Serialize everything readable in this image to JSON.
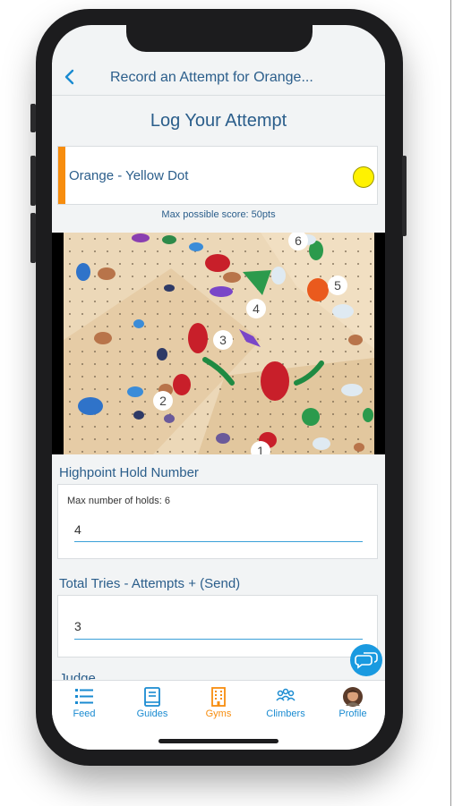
{
  "nav": {
    "title": "Record an Attempt for Orange..."
  },
  "heading": "Log Your Attempt",
  "route": {
    "name": "Orange - Yellow Dot",
    "stripe_color": "#f78d0e",
    "dot_color": "#fff200"
  },
  "max_score": "Max possible score: 50pts",
  "hold_numbers": [
    "1",
    "2",
    "3",
    "4",
    "5",
    "6"
  ],
  "highpoint": {
    "label": "Highpoint Hold Number",
    "hint": "Max number of holds: 6",
    "value": "4"
  },
  "tries": {
    "label": "Total Tries - Attempts + (Send)",
    "value": "3"
  },
  "judge_label": "Judge",
  "tabs": [
    {
      "label": "Feed",
      "icon": "feed-list-icon"
    },
    {
      "label": "Guides",
      "icon": "book-icon"
    },
    {
      "label": "Gyms",
      "icon": "building-icon",
      "active": true
    },
    {
      "label": "Climbers",
      "icon": "people-icon"
    },
    {
      "label": "Profile",
      "icon": "avatar-icon"
    }
  ],
  "colors": {
    "accent": "#1a8bd1",
    "title": "#2b5e8b",
    "active_tab": "#f78d0e"
  }
}
